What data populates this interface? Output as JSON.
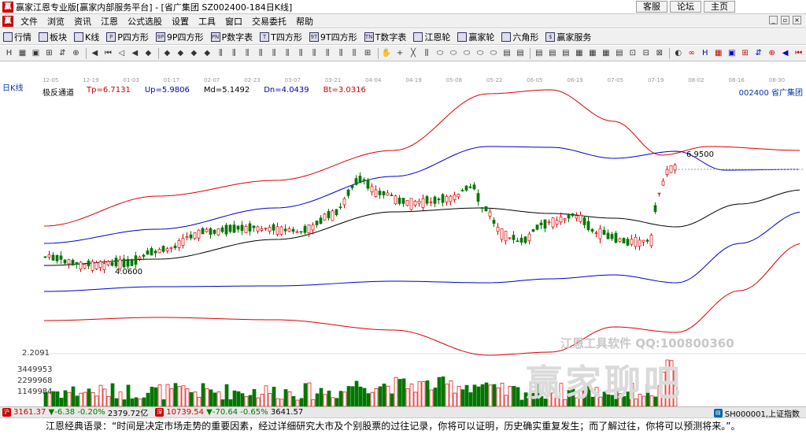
{
  "window": {
    "title": "赢家江恩专业版[赢家内部服务平台] - [省广集团  SZ002400-184日K线]",
    "top_links": [
      "客服",
      "论坛",
      "主页"
    ]
  },
  "menu": [
    "文件",
    "浏览",
    "资讯",
    "江恩",
    "公式选股",
    "设置",
    "工具",
    "窗口",
    "交易委托",
    "帮助"
  ],
  "toolbar1": [
    {
      "label": "行情",
      "icon": "grid-icon"
    },
    {
      "label": "板块",
      "icon": "block-icon"
    },
    {
      "label": "K线",
      "icon": "kline-icon"
    },
    {
      "label": "P四方形",
      "icon": "p-square-icon",
      "glyph": "P"
    },
    {
      "label": "9P四方形",
      "icon": "9p-square-icon",
      "glyph": "9P"
    },
    {
      "label": "P数字表",
      "icon": "p-table-icon",
      "glyph": "PN"
    },
    {
      "label": "T四方形",
      "icon": "t-square-icon",
      "glyph": "T"
    },
    {
      "label": "9T四方形",
      "icon": "9t-square-icon",
      "glyph": "9T"
    },
    {
      "label": "T数字表",
      "icon": "t-table-icon",
      "glyph": "TN"
    },
    {
      "label": "江恩轮",
      "icon": "gann-wheel-icon"
    },
    {
      "label": "赢家轮",
      "icon": "winner-wheel-icon"
    },
    {
      "label": "六角形",
      "icon": "hexagon-icon"
    },
    {
      "label": "赢家服务",
      "icon": "service-icon",
      "glyph": "$"
    }
  ],
  "toolbar2_count": 58,
  "chart": {
    "period": "日K线",
    "dates": [
      "12-05",
      "12-19",
      "01-03",
      "01-17",
      "02-07",
      "02-23",
      "03-07",
      "03-21",
      "04-04",
      "04-19",
      "05-08",
      "05-22",
      "06-05",
      "06-19",
      "07-05",
      "07-19",
      "08-02",
      "08-16",
      "08-30"
    ],
    "indicator": {
      "name": "极反通道",
      "tp": "Tp=6.7131",
      "up": "Up=5.9806",
      "md": "Md=5.1492",
      "dn": "Dn=4.0439",
      "bt": "Bt=3.0316"
    },
    "stock_tag": "002400  省广集团",
    "high_label": "6.9500",
    "low_label": "4.0600",
    "volume_labels": [
      "2.2091",
      "3449953",
      "2299968",
      "1149984"
    ]
  },
  "watermark": {
    "line": "江恩工具软件   QQ:100800360",
    "big": "赢家聊吧"
  },
  "status": {
    "sh": {
      "index": "3161.37",
      "change": "▼-6.38",
      "pct": "-0.20%",
      "amount": "2379.72亿"
    },
    "sz": {
      "index": "10739.54",
      "change": "▼-70.64",
      "pct": "-0.65%",
      "amount": "3641.57"
    },
    "right": "SH000001,上证指数"
  },
  "quote": "江恩经典语录：“时间是决定市场走势的重要因素，经过详细研究大市及个别股票的过往记录，你将可以证明，历史确实重复发生；而了解过往，你将可以预测将来。”。"
}
